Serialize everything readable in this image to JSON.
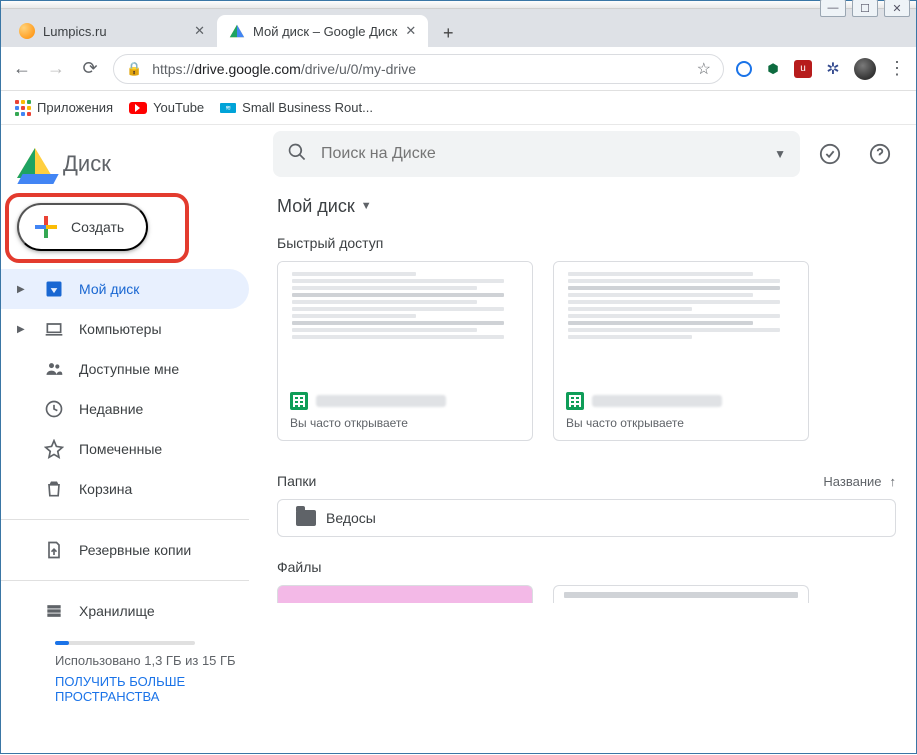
{
  "window": {
    "title": "Мой диск – Google Диск"
  },
  "browser": {
    "tabs": [
      {
        "title": "Lumpics.ru"
      },
      {
        "title": "Мой диск – Google Диск"
      }
    ],
    "url": {
      "proto": "https://",
      "host": "drive.google.com",
      "path": "/drive/u/0/my-drive"
    },
    "bookmarks": {
      "apps": "Приложения",
      "youtube": "YouTube",
      "sbr": "Small Business Rout..."
    }
  },
  "drive": {
    "brand": "Диск",
    "new_label": "Создать",
    "search_placeholder": "Поиск на Диске",
    "breadcrumb": "Мой диск",
    "nav": {
      "mydrive": "Мой диск",
      "computers": "Компьютеры",
      "shared": "Доступные мне",
      "recent": "Недавние",
      "starred": "Помеченные",
      "trash": "Корзина",
      "backups": "Резервные копии",
      "storage": "Хранилище"
    },
    "storage": {
      "used_text": "Использовано 1,3 ГБ из 15 ГБ",
      "upgrade": "ПОЛУЧИТЬ БОЛЬШЕ ПРОСТРАНСТВА"
    },
    "sections": {
      "quick": "Быстрый доступ",
      "folders": "Папки",
      "files": "Файлы"
    },
    "sort_label": "Название",
    "quick_sub": "Вы часто открываете",
    "folder_name": "Ведосы"
  }
}
